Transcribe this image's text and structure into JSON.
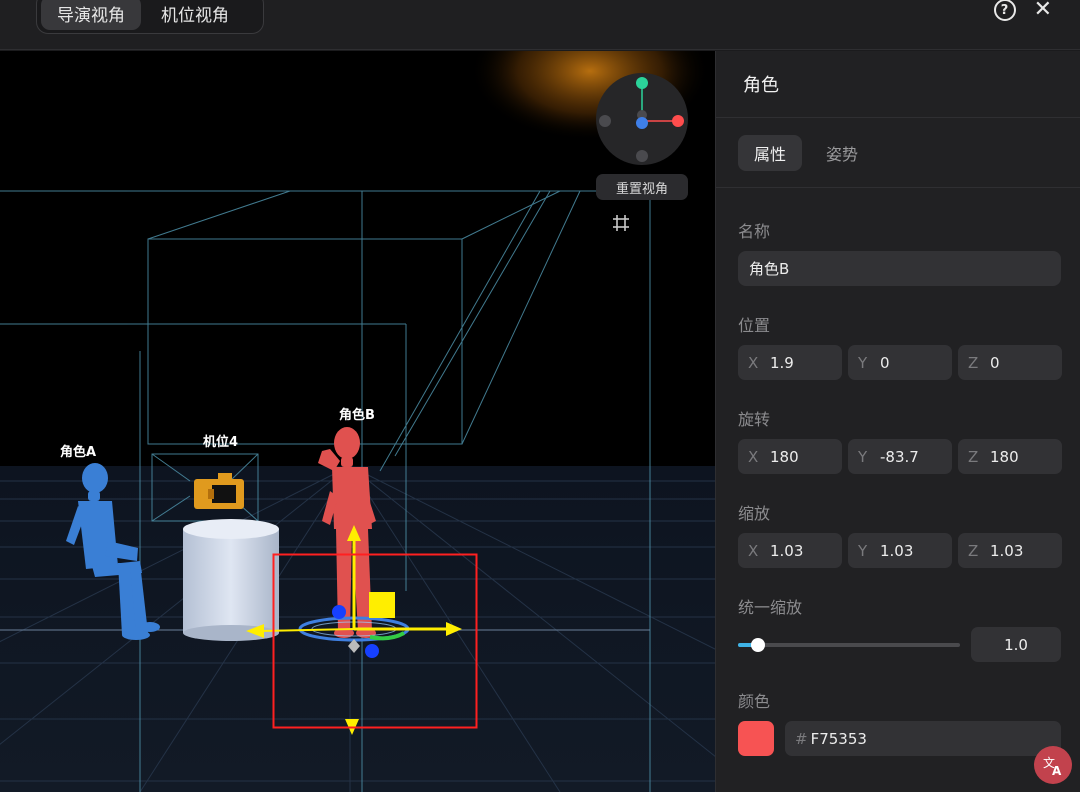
{
  "topbar": {
    "view_tabs": [
      {
        "label": "导演视角",
        "active": true
      },
      {
        "label": "机位视角",
        "active": false
      }
    ]
  },
  "viewport": {
    "reset_view_label": "重置视角",
    "labels": {
      "character_a": "角色A",
      "character_b": "角色B",
      "camera": "机位4"
    }
  },
  "panel": {
    "title": "角色",
    "tabs": [
      {
        "label": "属性",
        "active": true
      },
      {
        "label": "姿势",
        "active": false
      }
    ],
    "name": {
      "label": "名称",
      "value": "角色B"
    },
    "position": {
      "label": "位置",
      "x": "1.9",
      "y": "0",
      "z": "0"
    },
    "rotation": {
      "label": "旋转",
      "x": "180",
      "y": "-83.7",
      "z": "180"
    },
    "scale": {
      "label": "缩放",
      "x": "1.03",
      "y": "1.03",
      "z": "1.03"
    },
    "axis_labels": {
      "x": "X",
      "y": "Y",
      "z": "Z"
    },
    "uniform_scale": {
      "label": "统一缩放",
      "value": "1.0",
      "slider_fraction": 0.09
    },
    "color": {
      "label": "颜色",
      "hex": "F75353",
      "hash": "#"
    }
  },
  "colors": {
    "accent": "#3fb3e6",
    "character_a": "#3a7fd5",
    "character_b": "#e0514f",
    "camera": "#e09a1e",
    "selection": "#ff2020",
    "swatch": "#F75353"
  }
}
